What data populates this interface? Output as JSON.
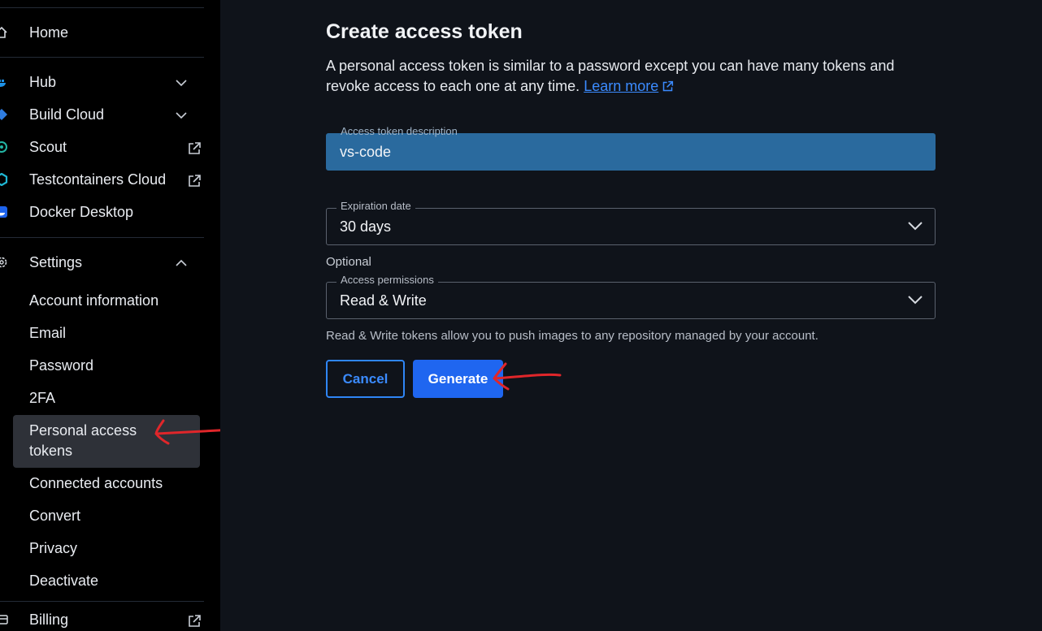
{
  "sidebar": {
    "items": [
      {
        "label": "Home",
        "icon": "home-icon"
      },
      {
        "label": "Hub",
        "icon": "docker-whale-icon",
        "trailing": "chevron-down-icon"
      },
      {
        "label": "Build Cloud",
        "icon": "build-cloud-icon",
        "trailing": "chevron-down-icon"
      },
      {
        "label": "Scout",
        "icon": "scout-icon",
        "trailing": "external-link-icon"
      },
      {
        "label": "Testcontainers Cloud",
        "icon": "testcontainers-icon",
        "trailing": "external-link-icon"
      },
      {
        "label": "Docker Desktop",
        "icon": "docker-desktop-icon"
      }
    ],
    "settings": {
      "label": "Settings",
      "icon": "gear-icon",
      "trailing": "chevron-up-icon",
      "subitems": [
        {
          "label": "Account information"
        },
        {
          "label": "Email"
        },
        {
          "label": "Password"
        },
        {
          "label": "2FA"
        },
        {
          "label": "Personal access tokens",
          "active": true
        },
        {
          "label": "Connected accounts"
        },
        {
          "label": "Convert"
        },
        {
          "label": "Privacy"
        },
        {
          "label": "Deactivate"
        }
      ]
    },
    "billing": {
      "label": "Billing",
      "icon": "billing-icon",
      "trailing": "external-link-icon"
    }
  },
  "main": {
    "title": "Create access token",
    "intro_text": "A personal access token is similar to a password except you can have many tokens and revoke access to each one at any time.",
    "learn_more": "Learn more",
    "description_field": {
      "label": "Access token description",
      "value": "vs-code"
    },
    "expiration_field": {
      "label": "Expiration date",
      "value": "30 days"
    },
    "optional_label": "Optional",
    "permissions_field": {
      "label": "Access permissions",
      "value": "Read & Write"
    },
    "permissions_help": "Read & Write tokens allow you to push images to any repository managed by your account.",
    "cancel_label": "Cancel",
    "generate_label": "Generate"
  },
  "colors": {
    "sidebar_bg": "#000000",
    "main_bg": "#0f131a",
    "accent": "#1f66f0",
    "link": "#3b8bff",
    "filled_field": "#2a6a9e",
    "annotation": "#e0262a"
  }
}
